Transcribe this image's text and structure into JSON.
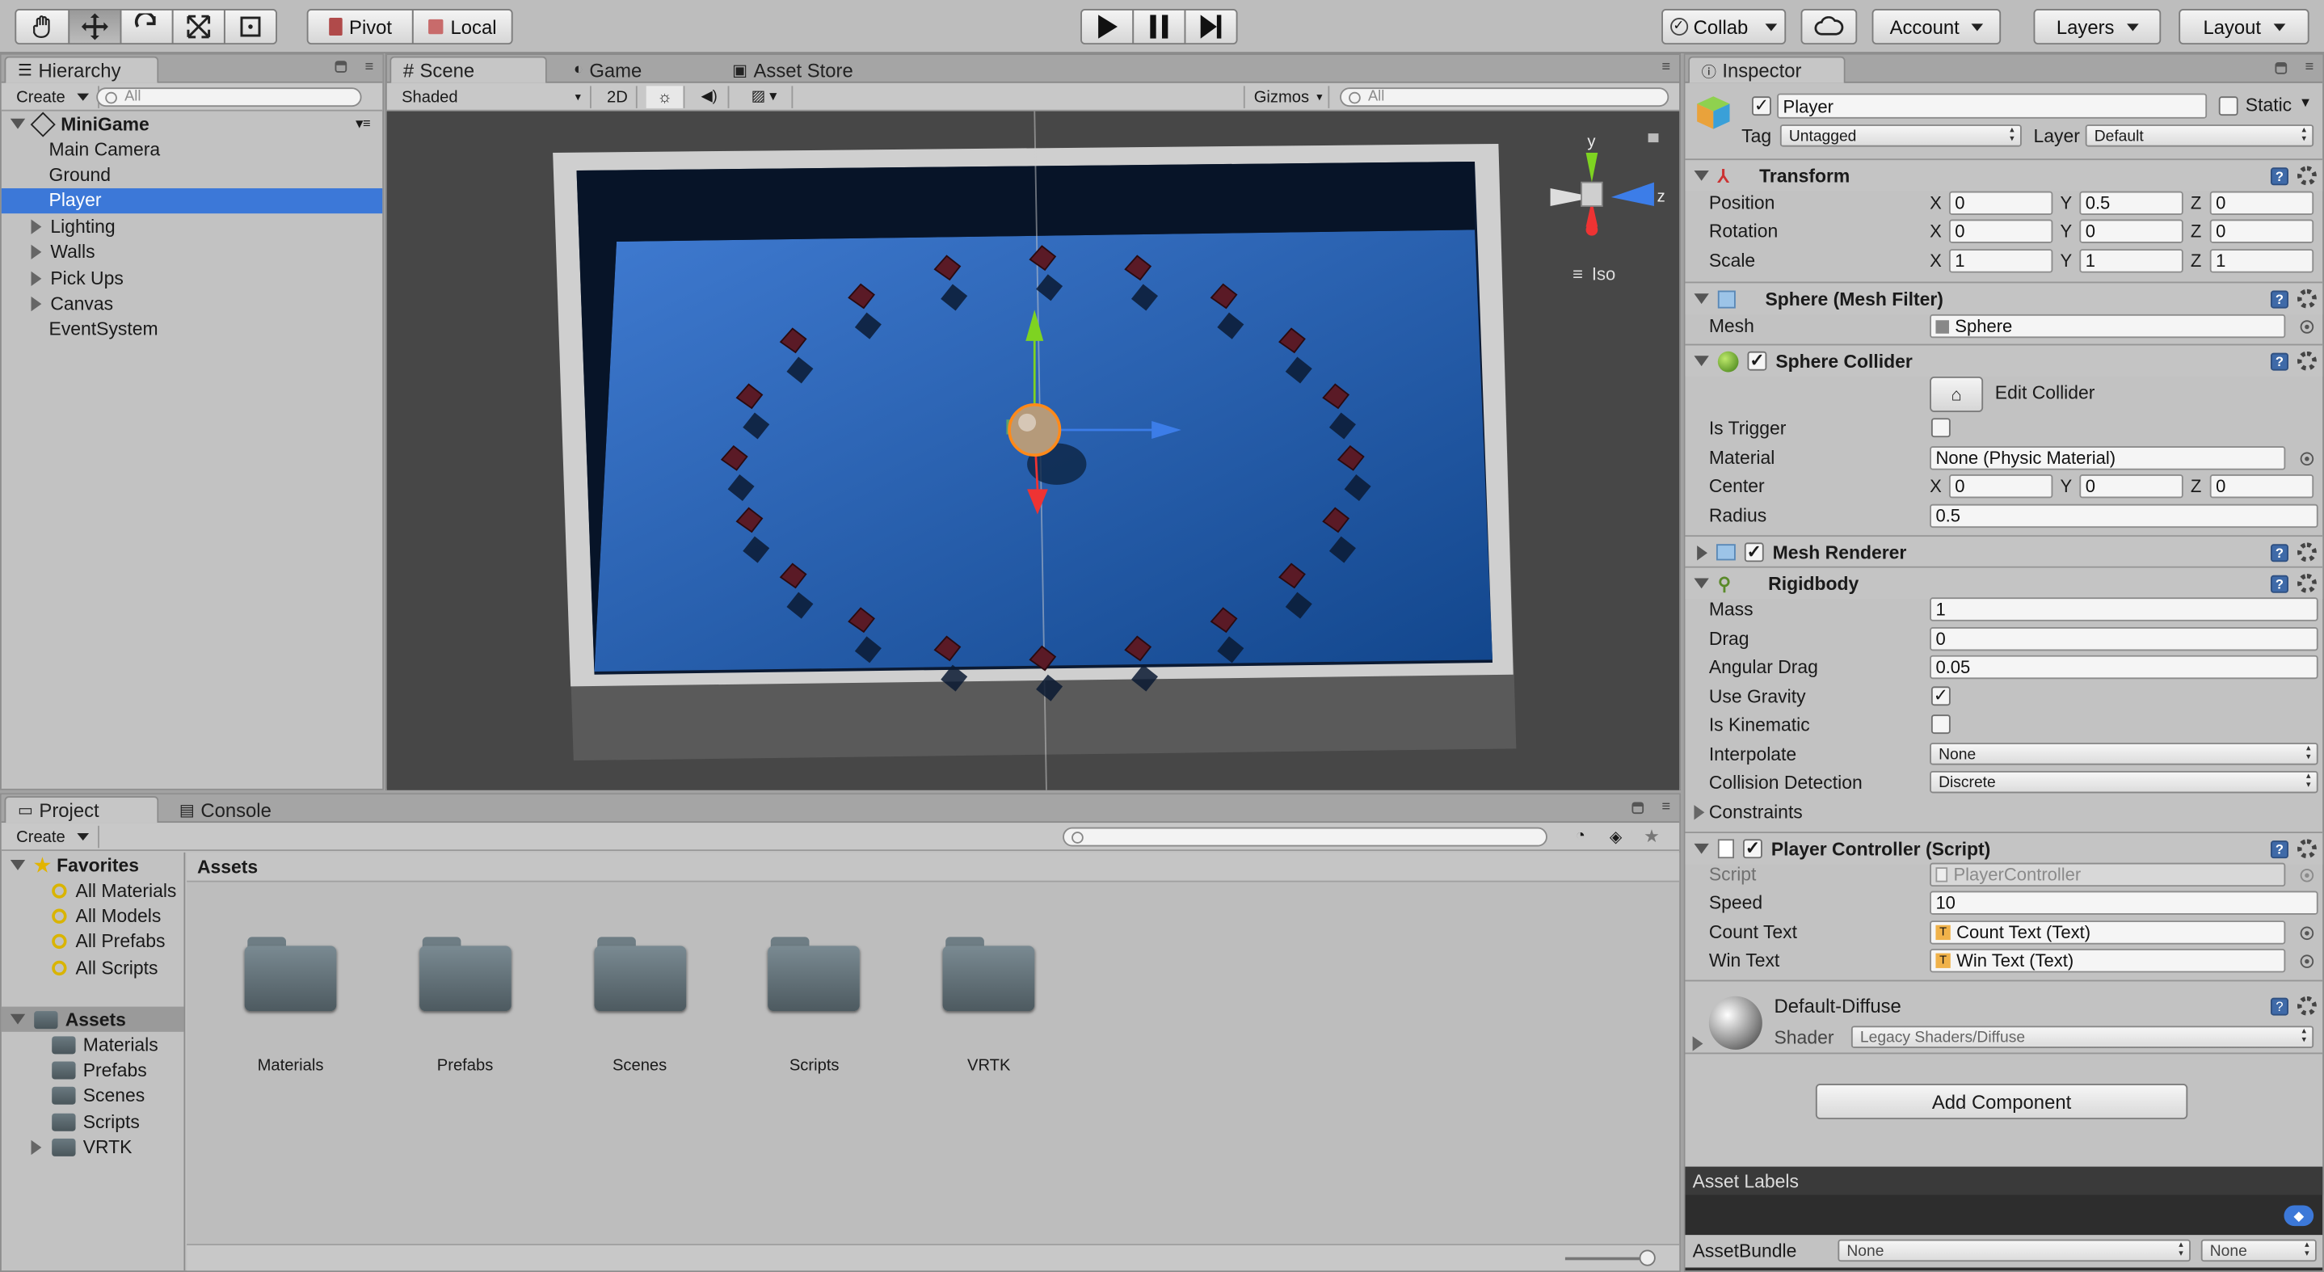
{
  "toolbar": {
    "tools": [
      "hand-tool",
      "move-tool",
      "rotate-tool",
      "scale-tool",
      "rect-tool"
    ],
    "pivot": "Pivot",
    "local": "Local",
    "collab": "Collab",
    "account": "Account",
    "layers": "Layers",
    "layout": "Layout"
  },
  "hierarchy": {
    "tab": "Hierarchy",
    "create": "Create",
    "search_placeholder": "All",
    "scene": "MiniGame",
    "items": [
      {
        "label": "Main Camera",
        "expandable": false
      },
      {
        "label": "Ground",
        "expandable": false
      },
      {
        "label": "Player",
        "expandable": false,
        "selected": true
      },
      {
        "label": "Lighting",
        "expandable": true
      },
      {
        "label": "Walls",
        "expandable": true
      },
      {
        "label": "Pick Ups",
        "expandable": true
      },
      {
        "label": "Canvas",
        "expandable": true
      },
      {
        "label": "EventSystem",
        "expandable": false
      }
    ]
  },
  "scene": {
    "tabs": [
      "Scene",
      "Game",
      "Asset Store"
    ],
    "shading": "Shaded",
    "mode_2d": "2D",
    "gizmos": "Gizmos",
    "search_placeholder": "All",
    "gizmo_y": "y",
    "gizmo_z": "z",
    "projection": "Iso"
  },
  "project": {
    "tabs": [
      "Project",
      "Console"
    ],
    "create": "Create",
    "favorites_label": "Favorites",
    "favorites": [
      "All Materials",
      "All Models",
      "All Prefabs",
      "All Scripts"
    ],
    "assets_label": "Assets",
    "asset_folders": [
      "Materials",
      "Prefabs",
      "Scenes",
      "Scripts",
      "VRTK"
    ],
    "breadcrumb": "Assets",
    "grid_folders": [
      "Materials",
      "Prefabs",
      "Scenes",
      "Scripts",
      "VRTK"
    ]
  },
  "inspector": {
    "tab": "Inspector",
    "object_name": "Player",
    "static_label": "Static",
    "tag_label": "Tag",
    "tag_value": "Untagged",
    "layer_label": "Layer",
    "layer_value": "Default",
    "transform": {
      "title": "Transform",
      "position_label": "Position",
      "position": [
        "0",
        "0.5",
        "0"
      ],
      "rotation_label": "Rotation",
      "rotation": [
        "0",
        "0",
        "0"
      ],
      "scale_label": "Scale",
      "scale": [
        "1",
        "1",
        "1"
      ]
    },
    "mesh_filter": {
      "title": "Sphere (Mesh Filter)",
      "mesh_label": "Mesh",
      "mesh_value": "Sphere"
    },
    "sphere_collider": {
      "title": "Sphere Collider",
      "edit_collider": "Edit Collider",
      "is_trigger_label": "Is Trigger",
      "material_label": "Material",
      "material_value": "None (Physic Material)",
      "center_label": "Center",
      "center": [
        "0",
        "0",
        "0"
      ],
      "radius_label": "Radius",
      "radius": "0.5"
    },
    "mesh_renderer": {
      "title": "Mesh Renderer"
    },
    "rigidbody": {
      "title": "Rigidbody",
      "mass_label": "Mass",
      "mass": "1",
      "drag_label": "Drag",
      "drag": "0",
      "angular_drag_label": "Angular Drag",
      "angular_drag": "0.05",
      "use_gravity_label": "Use Gravity",
      "is_kinematic_label": "Is Kinematic",
      "interpolate_label": "Interpolate",
      "interpolate": "None",
      "collision_label": "Collision Detection",
      "collision": "Discrete",
      "constraints_label": "Constraints"
    },
    "player_controller": {
      "title": "Player Controller (Script)",
      "script_label": "Script",
      "script_value": "PlayerController",
      "speed_label": "Speed",
      "speed": "10",
      "count_text_label": "Count Text",
      "count_text": "Count Text (Text)",
      "win_text_label": "Win Text",
      "win_text": "Win Text (Text)"
    },
    "material": {
      "name": "Default-Diffuse",
      "shader_label": "Shader",
      "shader": "Legacy Shaders/Diffuse"
    },
    "add_component": "Add Component",
    "asset_labels": "Asset Labels",
    "asset_bundle_label": "AssetBundle",
    "asset_bundle": "None",
    "asset_variant": "None",
    "axis_labels": [
      "X",
      "Y",
      "Z"
    ]
  }
}
